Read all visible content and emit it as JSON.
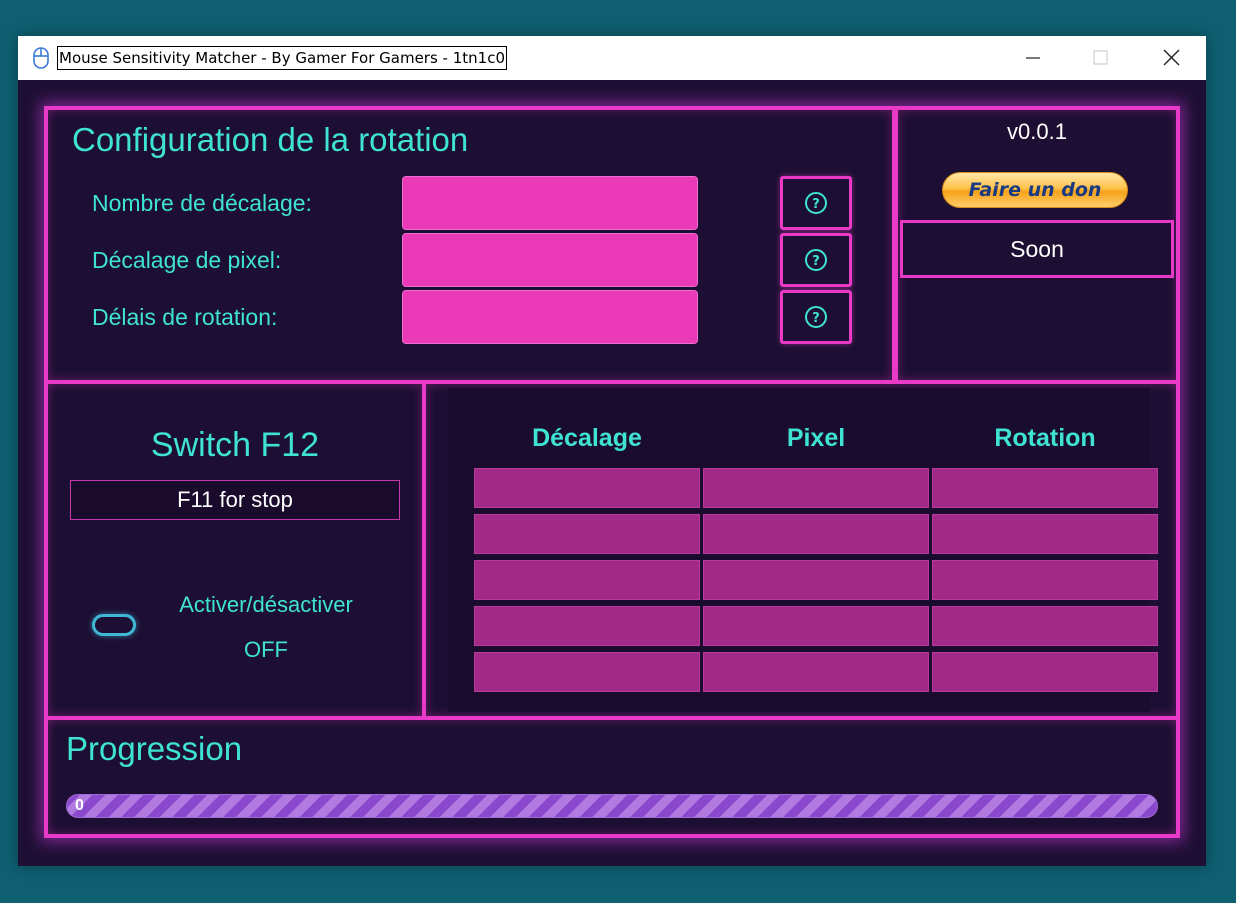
{
  "window": {
    "title": "Mouse Sensitivity Matcher - By Gamer For Gamers - 1tn1c0",
    "icon": "mouse-icon",
    "controls": [
      "minimize-icon",
      "maximize-icon",
      "close-icon"
    ]
  },
  "theme": {
    "accent": "#e83ac6",
    "text_accent": "#3fe3d3",
    "background": "#1d0f33",
    "input_fill": "#ea3ab8",
    "cell_fill": "#a22a87"
  },
  "config": {
    "title": "Configuration de la rotation",
    "fields": [
      {
        "label": "Nombre de décalage:",
        "value": "",
        "help_icon": "question-circle-icon"
      },
      {
        "label": "Décalage de pixel:",
        "value": "",
        "help_icon": "question-circle-icon"
      },
      {
        "label": "Délais de rotation:",
        "value": "",
        "help_icon": "question-circle-icon"
      }
    ]
  },
  "side": {
    "version": "v0.0.1",
    "donate_label": "Faire un don",
    "soon_label": "Soon"
  },
  "switch": {
    "title": "Switch F12",
    "stop_hint": "F11 for stop",
    "toggle_label": "Activer/désactiver",
    "toggle_state": "OFF"
  },
  "table": {
    "columns": [
      "Décalage",
      "Pixel",
      "Rotation"
    ],
    "rows": [
      [
        "",
        "",
        ""
      ],
      [
        "",
        "",
        ""
      ],
      [
        "",
        "",
        ""
      ],
      [
        "",
        "",
        ""
      ],
      [
        "",
        "",
        ""
      ]
    ]
  },
  "progress": {
    "title": "Progression",
    "value": "0",
    "fraction": 0
  }
}
